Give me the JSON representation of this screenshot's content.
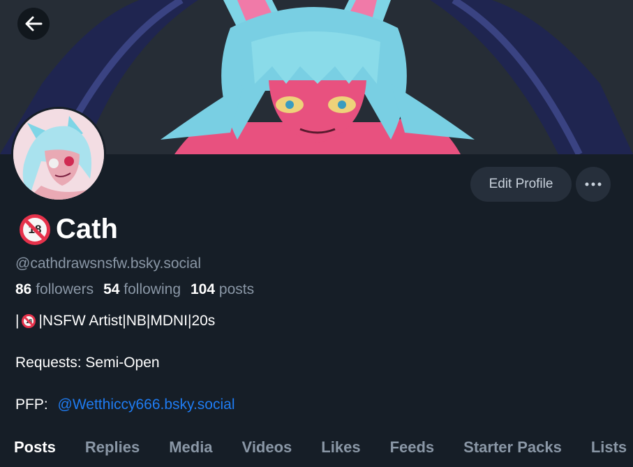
{
  "header": {
    "back_icon": "arrow-left-icon"
  },
  "profile": {
    "display_name": "Cath",
    "display_badge": "18",
    "handle": "@cathdrawsnsfw.bsky.social",
    "edit_label": "Edit Profile",
    "more_icon": "ellipsis-icon"
  },
  "stats": {
    "followers_count": "86",
    "followers_label": "followers",
    "following_count": "54",
    "following_label": "following",
    "posts_count": "104",
    "posts_label": "posts"
  },
  "bio": {
    "line1_prefix": "|",
    "line1_badge": "18",
    "line1_text": "|NSFW Artist|NB|MDNI|20s",
    "line2": "Requests: Semi-Open",
    "line3_label": "PFP: ",
    "line3_link": "@Wetthiccy666.bsky.social"
  },
  "tabs": [
    {
      "label": "Posts",
      "active": true
    },
    {
      "label": "Replies"
    },
    {
      "label": "Media"
    },
    {
      "label": "Videos"
    },
    {
      "label": "Likes"
    },
    {
      "label": "Feeds"
    },
    {
      "label": "Starter Packs"
    },
    {
      "label": "Lists"
    }
  ],
  "colors": {
    "background": "#161e27",
    "accent": "#1f7cf2",
    "button": "#262f3b"
  }
}
